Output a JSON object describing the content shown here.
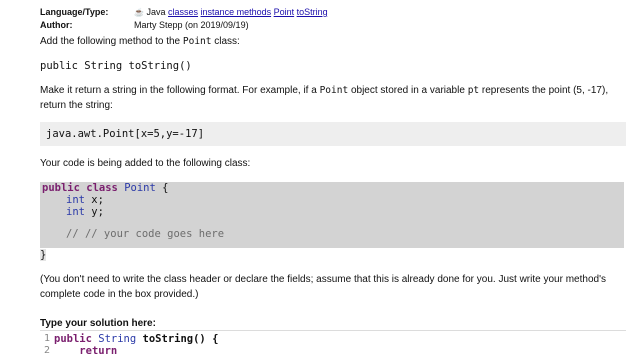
{
  "meta": {
    "language_key": "Language/Type:",
    "language_value": "Java",
    "tags": [
      "classes",
      "instance methods",
      "Point",
      "toString"
    ],
    "author_key": "Author:",
    "author_value": "Marty Stepp (on 2019/09/19)"
  },
  "instructions": {
    "add_method_prefix": "Add the following method to the ",
    "add_method_class": "Point",
    "add_method_suffix": " class:",
    "signature": "public String toString()",
    "format_line_1a": "Make it return a string in the following format. For example, if a ",
    "format_line_1b": "Point",
    "format_line_1c": " object stored in a variable ",
    "format_line_1d": "pt",
    "format_line_1e": " represents the point (5, -17),",
    "format_line_2": "return the string:",
    "example_output": "java.awt.Point[x=5,y=-17]",
    "added_to_class": "Your code is being added to the following class:",
    "note_line_1": "(You don't need to write the class header or declare the fields; assume that this is already done for you. Just write your method's",
    "note_line_2": "complete code in the box provided.)"
  },
  "class_code": {
    "kw_public": "public",
    "kw_class": "class",
    "class_name": "Point",
    "open_brace": "{",
    "type_int_1": "int",
    "field_x": "x;",
    "type_int_2": "int",
    "field_y": "y;",
    "comment": "// // your code goes here",
    "close_brace": "}"
  },
  "solution": {
    "label": "Type your solution here:",
    "line_numbers": [
      "1",
      "2"
    ],
    "line1_kw_public": "public",
    "line1_type": "String",
    "line1_rest": "toString() {",
    "line2_kw_return": "return"
  }
}
